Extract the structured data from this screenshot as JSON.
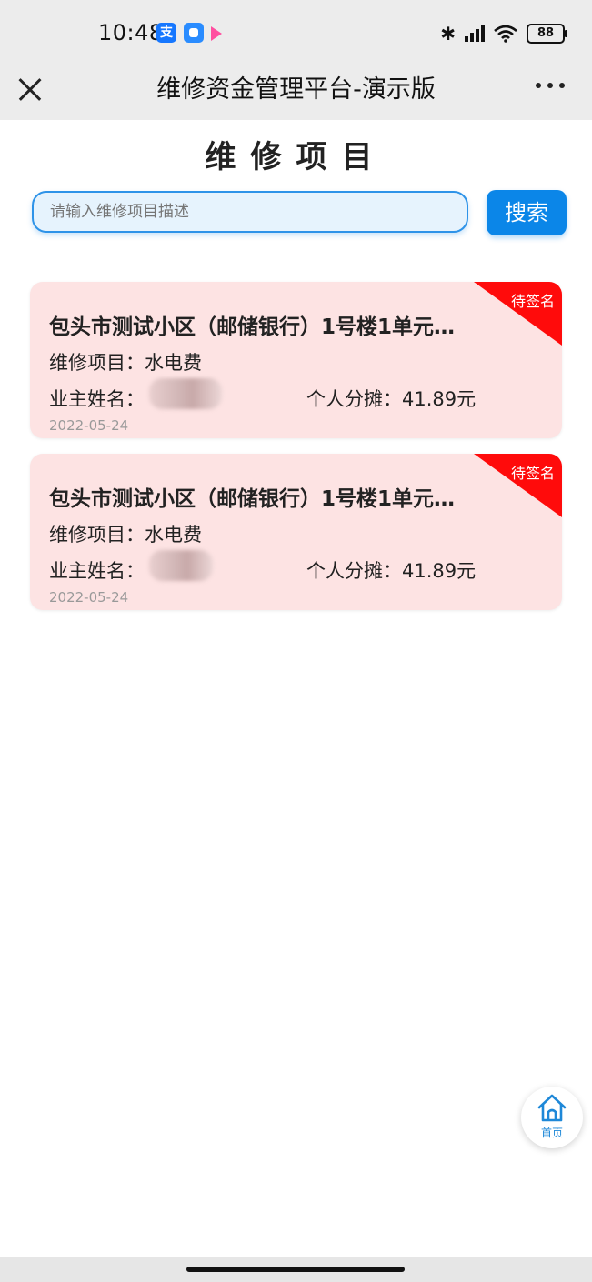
{
  "status_bar": {
    "time": "10:48",
    "app_icons": [
      "alipay-icon",
      "chat-app-icon",
      "video-app-icon"
    ],
    "battery": "88",
    "icons": [
      "bluetooth-icon",
      "signal-icon",
      "wifi-icon",
      "battery-icon"
    ]
  },
  "nav": {
    "title": "维修资金管理平台-演示版",
    "close_icon": "close-icon",
    "more_icon": "more-icon"
  },
  "page": {
    "title": "维修项目"
  },
  "search": {
    "placeholder": "请输入维修项目描述",
    "button_label": "搜索"
  },
  "projects": [
    {
      "status": "待签名",
      "title": "包头市测试小区（邮储银行）1号楼1单元…",
      "item_label": "维修项目：",
      "item_value": "水电费",
      "owner_label": "业主姓名：",
      "share_label": "个人分摊：",
      "share_value": "41.89元",
      "date": "2022-05-24"
    },
    {
      "status": "待签名",
      "title": "包头市测试小区（邮储银行）1号楼1单元…",
      "item_label": "维修项目：",
      "item_value": "水电费",
      "owner_label": "业主姓名：",
      "share_label": "个人分摊：",
      "share_value": "41.89元",
      "date": "2022-05-24"
    }
  ],
  "home_button": {
    "label": "首页",
    "icon": "home-icon"
  },
  "colors": {
    "accent": "#0b86e8",
    "card_bg": "#fde3e3",
    "status_ribbon": "#ff0b0b"
  }
}
